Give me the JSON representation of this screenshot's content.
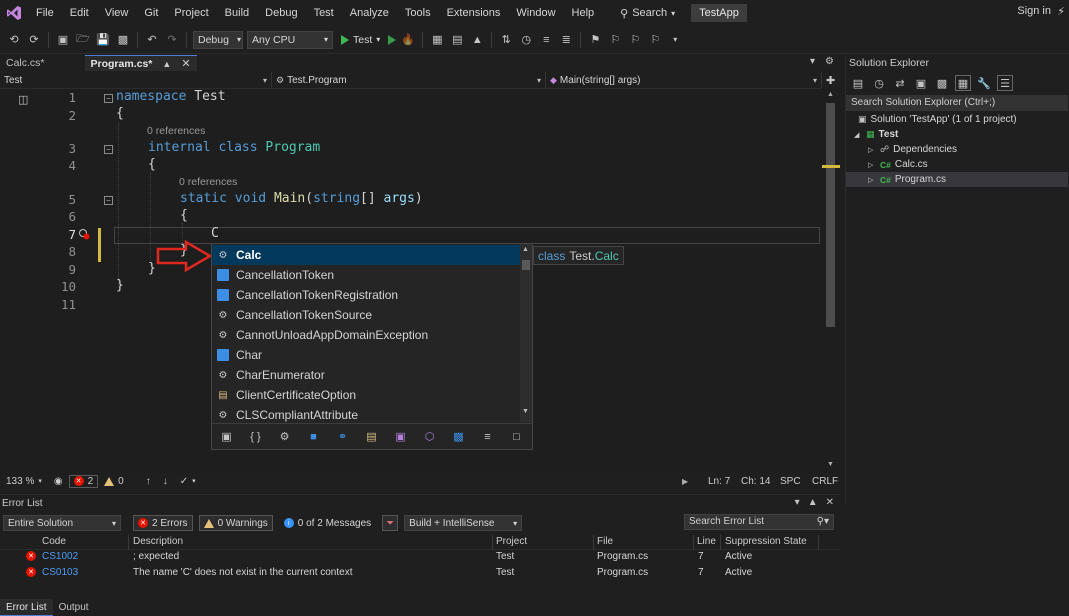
{
  "menu": {
    "items": [
      "File",
      "Edit",
      "View",
      "Git",
      "Project",
      "Build",
      "Debug",
      "Test",
      "Analyze",
      "Tools",
      "Extensions",
      "Window",
      "Help"
    ],
    "search_label": "Search",
    "solution_title": "TestApp",
    "sign_in": "Sign in"
  },
  "toolbar": {
    "config": "Debug",
    "platform": "Any CPU",
    "run_label": "Test"
  },
  "tabs": [
    {
      "label": "Calc.cs*"
    },
    {
      "label": "Program.cs*"
    }
  ],
  "navbar": {
    "project": "Test",
    "type": "Test.Program",
    "member": "Main(string[] args)"
  },
  "editor": {
    "line_numbers": [
      "1",
      "2",
      "3",
      "4",
      "5",
      "6",
      "7",
      "8",
      "9",
      "10",
      "11"
    ],
    "refs": [
      "0 references",
      "0 references"
    ],
    "typed_text": "C",
    "code": {
      "l1_kw": "namespace",
      "l1_name": "Test",
      "brace_open": "{",
      "brace_close": "}",
      "l3_kw1": "internal",
      "l3_kw2": "class",
      "l3_name": "Program",
      "l5_kw1": "static",
      "l5_kw2": "void",
      "l5_fn": "Main",
      "l5_paren_open": "(",
      "l5_type": "string",
      "l5_brackets": "[]",
      "l5_param": "args",
      "l5_paren_close": ")"
    }
  },
  "completion": {
    "items": [
      {
        "label": "Calc",
        "icon": "class-icon"
      },
      {
        "label": "CancellationToken",
        "icon": "struct-icon"
      },
      {
        "label": "CancellationTokenRegistration",
        "icon": "struct-icon"
      },
      {
        "label": "CancellationTokenSource",
        "icon": "class-icon"
      },
      {
        "label": "CannotUnloadAppDomainException",
        "icon": "class-icon"
      },
      {
        "label": "Char",
        "icon": "struct-icon"
      },
      {
        "label": "CharEnumerator",
        "icon": "class-icon"
      },
      {
        "label": "ClientCertificateOption",
        "icon": "enum-icon"
      },
      {
        "label": "CLSCompliantAttribute",
        "icon": "class-icon"
      }
    ],
    "tooltip_kw": "class",
    "tooltip_ns": "Test.",
    "tooltip_type": "Calc"
  },
  "status": {
    "zoom": "133 %",
    "errors": "2",
    "warnings": "0",
    "ln": "Ln: 7",
    "ch": "Ch: 14",
    "spc": "SPC",
    "crlf": "CRLF"
  },
  "solution_explorer": {
    "title": "Solution Explorer",
    "search_placeholder": "Search Solution Explorer (Ctrl+;)",
    "solution": "Solution 'TestApp' (1 of 1 project)",
    "project": "Test",
    "items": [
      "Dependencies",
      "Calc.cs",
      "Program.cs"
    ],
    "cs_badge": "C#"
  },
  "error_list": {
    "title": "Error List",
    "scope": "Entire Solution",
    "errors_chip": "2 Errors",
    "warnings_chip": "0 Warnings",
    "messages_chip": "0 of 2 Messages",
    "build_filter": "Build + IntelliSense",
    "search_placeholder": "Search Error List",
    "columns": [
      "Code",
      "Description",
      "Project",
      "File",
      "Line",
      "Suppression State"
    ],
    "rows": [
      {
        "code": "CS1002",
        "description": "; expected",
        "project": "Test",
        "file": "Program.cs",
        "line": "7",
        "state": "Active"
      },
      {
        "code": "CS0103",
        "description": "The name 'C' does not exist in the current context",
        "project": "Test",
        "file": "Program.cs",
        "line": "7",
        "state": "Active"
      }
    ]
  },
  "bottom_tabs": [
    "Error List",
    "Output"
  ],
  "colors": {
    "keyword": "#569cd6",
    "type": "#4ec9b0",
    "method": "#dcdcaa",
    "param": "#9cdcfe",
    "selection": "#04395e",
    "error": "#e51400",
    "accent": "#4e7fd9"
  }
}
